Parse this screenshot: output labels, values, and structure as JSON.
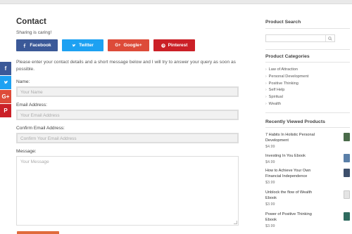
{
  "page_title": "Contact",
  "sharing_caring": "Sharing is caring!",
  "share_buttons": [
    {
      "label": "Facebook",
      "color": "#3b5998",
      "icon": "facebook-icon"
    },
    {
      "label": "Twitter",
      "color": "#1da1f2",
      "icon": "twitter-icon"
    },
    {
      "label": "Google+",
      "color": "#dd4b39",
      "icon": "google-plus-icon"
    },
    {
      "label": "Pinterest",
      "color": "#cb2027",
      "icon": "pinterest-icon"
    }
  ],
  "floating_share": [
    {
      "icon": "facebook-icon",
      "glyph": "f",
      "color": "#3b5998"
    },
    {
      "icon": "twitter-icon",
      "glyph": "",
      "color": "#1da1f2"
    },
    {
      "icon": "google-plus-icon",
      "glyph": "G+",
      "color": "#dd4b39"
    },
    {
      "icon": "pinterest-icon",
      "glyph": "P",
      "color": "#cb2027"
    }
  ],
  "intro": "Please enter your contact details and a short message below and I will try to answer your query as soon as possible.",
  "form": {
    "name_label": "Name:",
    "name_placeholder": "Your Name",
    "email_label": "Email Address:",
    "email_placeholder": "Your Email Address",
    "confirm_label": "Confirm Email Address:",
    "confirm_placeholder": "Confirm Your Email Address",
    "message_label": "Message:",
    "message_placeholder": "Your Message"
  },
  "sidebar": {
    "search_title": "Product Search",
    "categories_title": "Product Categories",
    "categories": [
      "Law of Attraction",
      "Personal Development",
      "Positive Thinking",
      "Self Help",
      "Spiritual",
      "Wealth"
    ],
    "recently_viewed_title": "Recently Viewed Products",
    "recently_viewed": [
      {
        "name": "7 Habits In Holistic Personal Development",
        "price": "$4.99",
        "thumb_color": "#4a6b4a"
      },
      {
        "name": "Investing In You Ebook",
        "price": "$4.99",
        "thumb_color": "#5a7fa8"
      },
      {
        "name": "How to Achieve Your Own Financial Independence",
        "price": "$3.99",
        "thumb_color": "#3d4f6b"
      },
      {
        "name": "Unblock the flow of Wealth Ebook",
        "price": "$3.99",
        "thumb_color": "#c9c9c9"
      },
      {
        "name": "Power of Positive Thinking Ebook",
        "price": "$3.99",
        "thumb_color": "#2f6b5f"
      }
    ]
  }
}
